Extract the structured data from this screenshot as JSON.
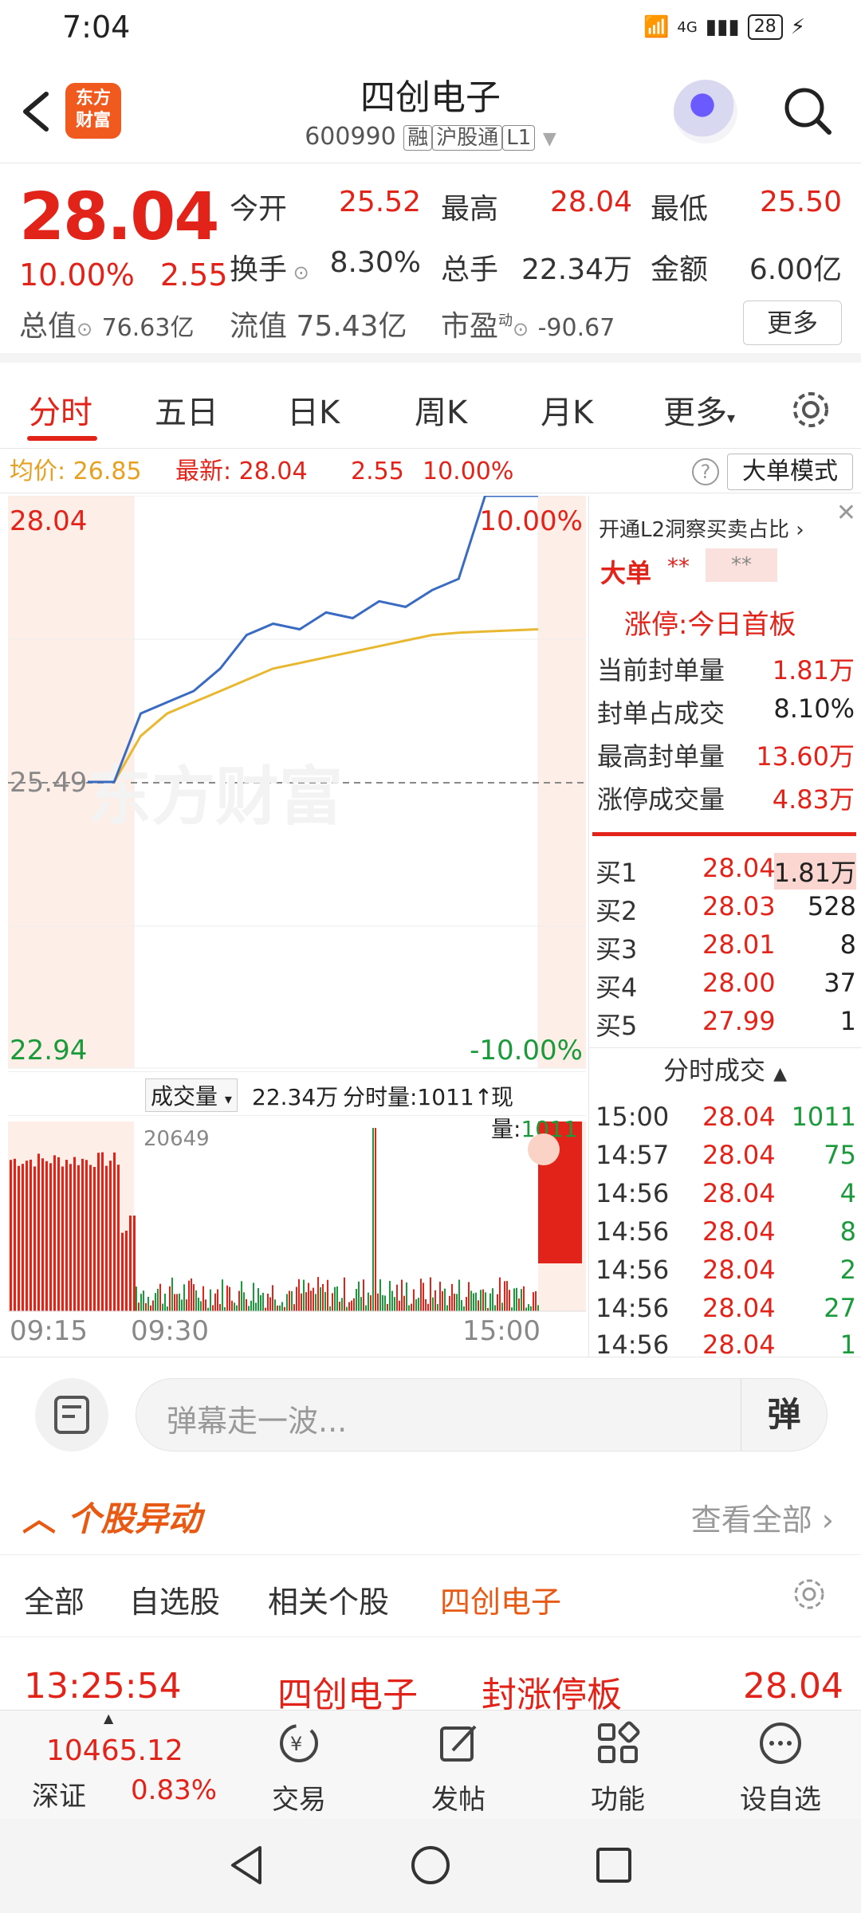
{
  "status_bar": {
    "time": "7:04",
    "network": "4G",
    "battery": "28"
  },
  "header": {
    "logo_line1": "东方",
    "logo_line2": "财富",
    "stock_name": "四创电子",
    "stock_code": "600990",
    "tags": [
      "融",
      "沪股通",
      "L1"
    ]
  },
  "quote": {
    "price": "28.04",
    "change_pct": "10.00%",
    "change_amt": "2.55",
    "open_label": "今开",
    "open": "25.52",
    "high_label": "最高",
    "high": "28.04",
    "low_label": "最低",
    "low": "25.50",
    "turnover_label": "换手",
    "turnover": "8.30%",
    "volume_label": "总手",
    "volume": "22.34万",
    "amount_label": "金额",
    "amount": "6.00亿",
    "mktcap_label": "总值",
    "mktcap": "76.63亿",
    "float_label": "流值",
    "float": "75.43亿",
    "pe_label": "市盈",
    "pe_sup": "动",
    "pe": "-90.67",
    "more_button": "更多"
  },
  "tabs": [
    "分时",
    "五日",
    "日K",
    "周K",
    "月K",
    "更多"
  ],
  "active_tab": 0,
  "info_line": {
    "avg_label": "均价:",
    "avg": "26.85",
    "latest_label": "最新:",
    "latest": "28.04",
    "chg_amt": "2.55",
    "chg_pct": "10.00%",
    "big_order_mode": "大单模式"
  },
  "chart": {
    "price_top": "28.04",
    "pct_top": "10.00%",
    "mid_price": "25.49",
    "price_bottom": "22.94",
    "pct_bottom": "-10.00%",
    "watermark": "东方财富",
    "volume_label": "成交量",
    "total_volume": "22.34万",
    "tick_volume_label": "分时量:1011↑",
    "now_label": "现量:",
    "now_value": "1011",
    "vol_max": "20649",
    "x_start": "09:15",
    "x_mid": "09:30",
    "x_end": "15:00"
  },
  "chart_data": {
    "type": "line",
    "ylim": [
      22.94,
      28.04
    ],
    "series": [
      {
        "values": [
          25.49,
          25.49,
          26.1,
          26.2,
          26.3,
          26.5,
          26.8,
          26.9,
          26.85,
          27.0,
          26.95,
          27.1,
          27.05,
          27.2,
          27.3,
          28.04,
          28.04,
          28.04
        ]
      },
      {
        "values": [
          25.49,
          25.49,
          25.9,
          26.1,
          26.2,
          26.3,
          26.4,
          26.5,
          26.55,
          26.6,
          26.65,
          26.7,
          26.75,
          26.8,
          26.82,
          26.83,
          26.84,
          26.85
        ]
      }
    ]
  },
  "right_panel": {
    "l2_promo": "开通L2洞察买卖占比",
    "big_order_label": "大单",
    "big_order_value": "**",
    "big_order_value2": "**",
    "limit_up_title": "涨停:今日首板",
    "rows": [
      {
        "label": "当前封单量",
        "value": "1.81万"
      },
      {
        "label": "封单占成交",
        "value": "8.10%"
      },
      {
        "label": "最高封单量",
        "value": "13.60万"
      },
      {
        "label": "涨停成交量",
        "value": "4.83万"
      }
    ],
    "orderbook": [
      {
        "k": "买1",
        "p": "28.04",
        "q": "1.81万"
      },
      {
        "k": "买2",
        "p": "28.03",
        "q": "528"
      },
      {
        "k": "买3",
        "p": "28.01",
        "q": "8"
      },
      {
        "k": "买4",
        "p": "28.00",
        "q": "37"
      },
      {
        "k": "买5",
        "p": "27.99",
        "q": "1"
      }
    ],
    "trades_title": "分时成交",
    "trades": [
      {
        "t": "15:00",
        "p": "28.04",
        "q": "1011"
      },
      {
        "t": "14:57",
        "p": "28.04",
        "q": "75"
      },
      {
        "t": "14:56",
        "p": "28.04",
        "q": "4"
      },
      {
        "t": "14:56",
        "p": "28.04",
        "q": "8"
      },
      {
        "t": "14:56",
        "p": "28.04",
        "q": "2"
      },
      {
        "t": "14:56",
        "p": "28.04",
        "q": "27"
      },
      {
        "t": "14:56",
        "p": "28.04",
        "q": "1"
      }
    ]
  },
  "comment_bar": {
    "placeholder": "弹幕走一波...",
    "danmu_button": "弹"
  },
  "movers": {
    "title": "个股异动",
    "view_all": "查看全部",
    "tabs": [
      "全部",
      "自选股",
      "相关个股",
      "四创电子"
    ],
    "active_tab": 3,
    "row": {
      "time": "13:25:54",
      "name": "四创电子",
      "event": "封涨停板",
      "price": "28.04"
    }
  },
  "bottom_nav": {
    "index_value": "10465.12",
    "index_name": "深证",
    "index_pct": "0.83%",
    "items": [
      "交易",
      "发帖",
      "功能",
      "设自选"
    ]
  },
  "colors": {
    "up": "#e2231a",
    "down": "#1a9a3a",
    "accent": "#e85a14",
    "price_line": "#3a6bc2",
    "avg_line": "#e8b830"
  }
}
